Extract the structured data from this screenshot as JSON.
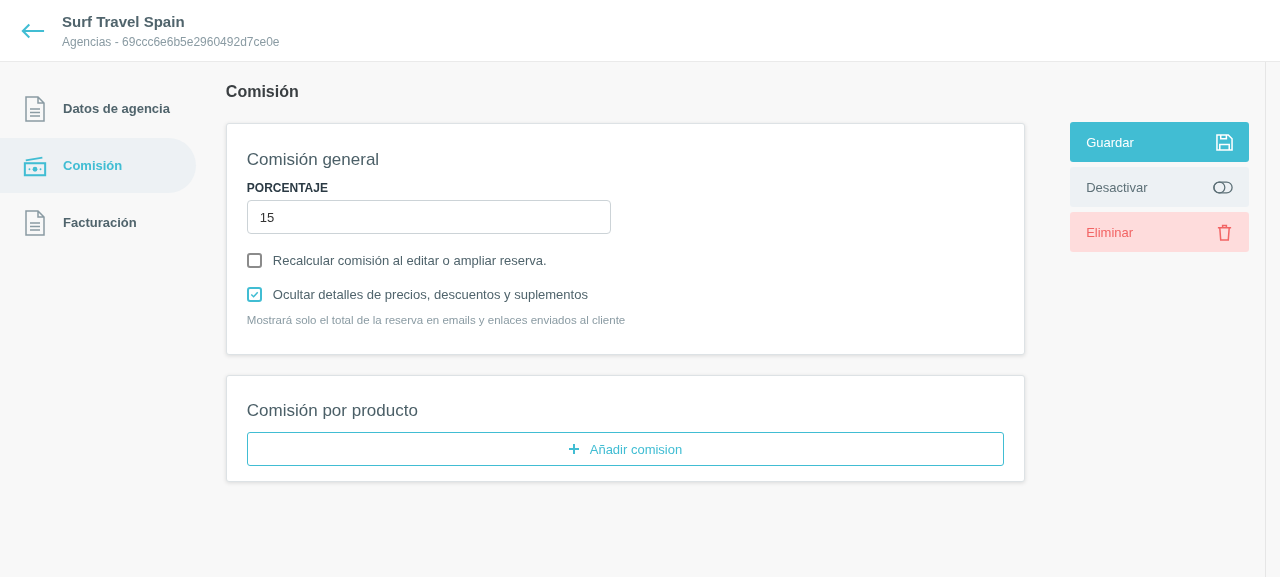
{
  "header": {
    "title": "Surf Travel Spain",
    "subtitle": "Agencias - 69ccc6e6b5e2960492d7ce0e"
  },
  "sidebar": {
    "items": [
      {
        "label": "Datos de agencia",
        "selected": false
      },
      {
        "label": "Comisión",
        "selected": true
      },
      {
        "label": "Facturación",
        "selected": false
      }
    ]
  },
  "page_title": "Comisión",
  "general": {
    "title": "Comisión general",
    "field_label": "PORCENTAJE",
    "value": "15",
    "options": [
      {
        "label": "Recalcular comisión al editar o ampliar reserva.",
        "checked": false
      },
      {
        "label": "Ocultar detalles de precios, descuentos y suplementos",
        "checked": true,
        "hint": "Mostrará solo el total de la reserva en emails y enlaces enviados al cliente"
      }
    ]
  },
  "product": {
    "title": "Comisión por producto",
    "add_button": "Añadir comision"
  },
  "actions": [
    {
      "label": "Guardar",
      "kind": "primary"
    },
    {
      "label": "Desactivar",
      "kind": "secondary"
    },
    {
      "label": "Eliminar",
      "kind": "danger"
    }
  ]
}
